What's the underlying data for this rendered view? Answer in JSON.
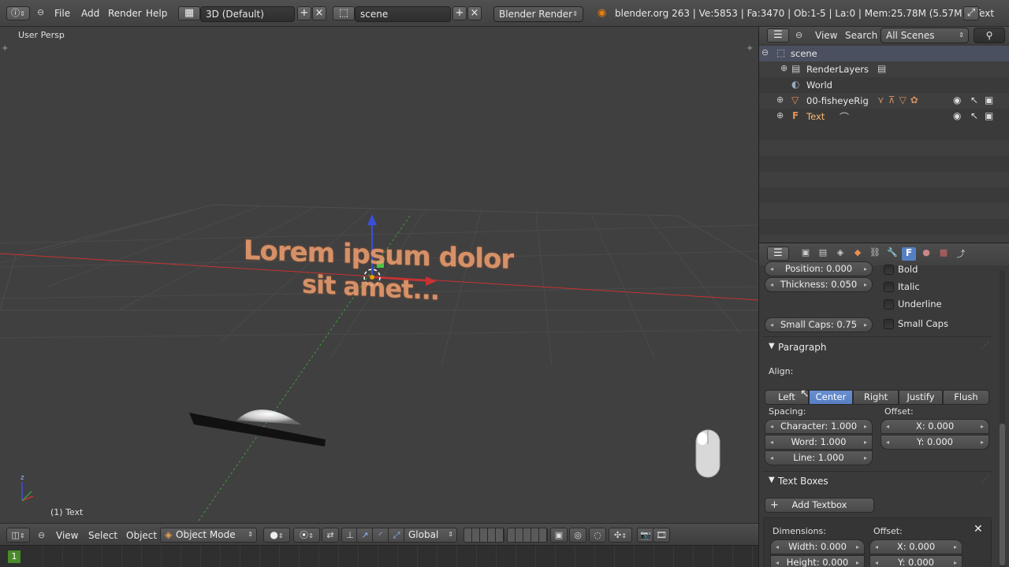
{
  "topbar": {
    "menus": [
      "File",
      "Add",
      "Render",
      "Help"
    ],
    "layout": "3D (Default)",
    "scene": "scene",
    "engine": "Blender Render",
    "stats": "blender.org 263 | Ve:5853 | Fa:3470 | Ob:1-5 | La:0 | Mem:25.78M (5.57M) | Text"
  },
  "viewport": {
    "view_label": "User Persp",
    "object_label": "(1) Text",
    "text_line1": "Lorem ipsum dolor",
    "text_line2": "sit amet...",
    "axis_x": "x",
    "axis_y": "y",
    "axis_z": "z"
  },
  "viewport_header": {
    "menus": [
      "View",
      "Select",
      "Object"
    ],
    "mode": "Object Mode",
    "orientation": "Global"
  },
  "timeline": {
    "frame": "1"
  },
  "outliner": {
    "menus": [
      "View",
      "Search"
    ],
    "display": "All Scenes",
    "items": [
      {
        "label": "scene"
      },
      {
        "label": "RenderLayers"
      },
      {
        "label": "World"
      },
      {
        "label": "00-fisheyeRig"
      },
      {
        "label": "Text"
      }
    ]
  },
  "properties": {
    "position": "Position: 0.000",
    "thickness": "Thickness: 0.050",
    "small_caps_scale": "Small Caps: 0.75",
    "checks": [
      "Bold",
      "Italic",
      "Underline",
      "Small Caps"
    ],
    "paragraph": {
      "title": "Paragraph",
      "align_label": "Align:",
      "align": [
        "Left",
        "Center",
        "Right",
        "Justify",
        "Flush"
      ],
      "active_align": "Center",
      "spacing_label": "Spacing:",
      "offset_label": "Offset:",
      "character": "Character: 1.000",
      "word": "Word: 1.000",
      "line": "Line: 1.000",
      "offset_x": "X: 0.000",
      "offset_y": "Y: 0.000"
    },
    "text_boxes": {
      "title": "Text Boxes",
      "add_textbox": "Add Textbox",
      "dimensions_label": "Dimensions:",
      "offset_label": "Offset:",
      "width": "Width: 0.000",
      "height": "Height: 0.000",
      "offset_x": "X: 0.000",
      "offset_y": "Y: 0.000"
    }
  },
  "colors": {
    "accent": "#5680c4",
    "axis_x": "#c83232",
    "axis_z": "#3a4fd8",
    "axis_y": "#3c9b3c",
    "text_3d": "#f0a070"
  }
}
